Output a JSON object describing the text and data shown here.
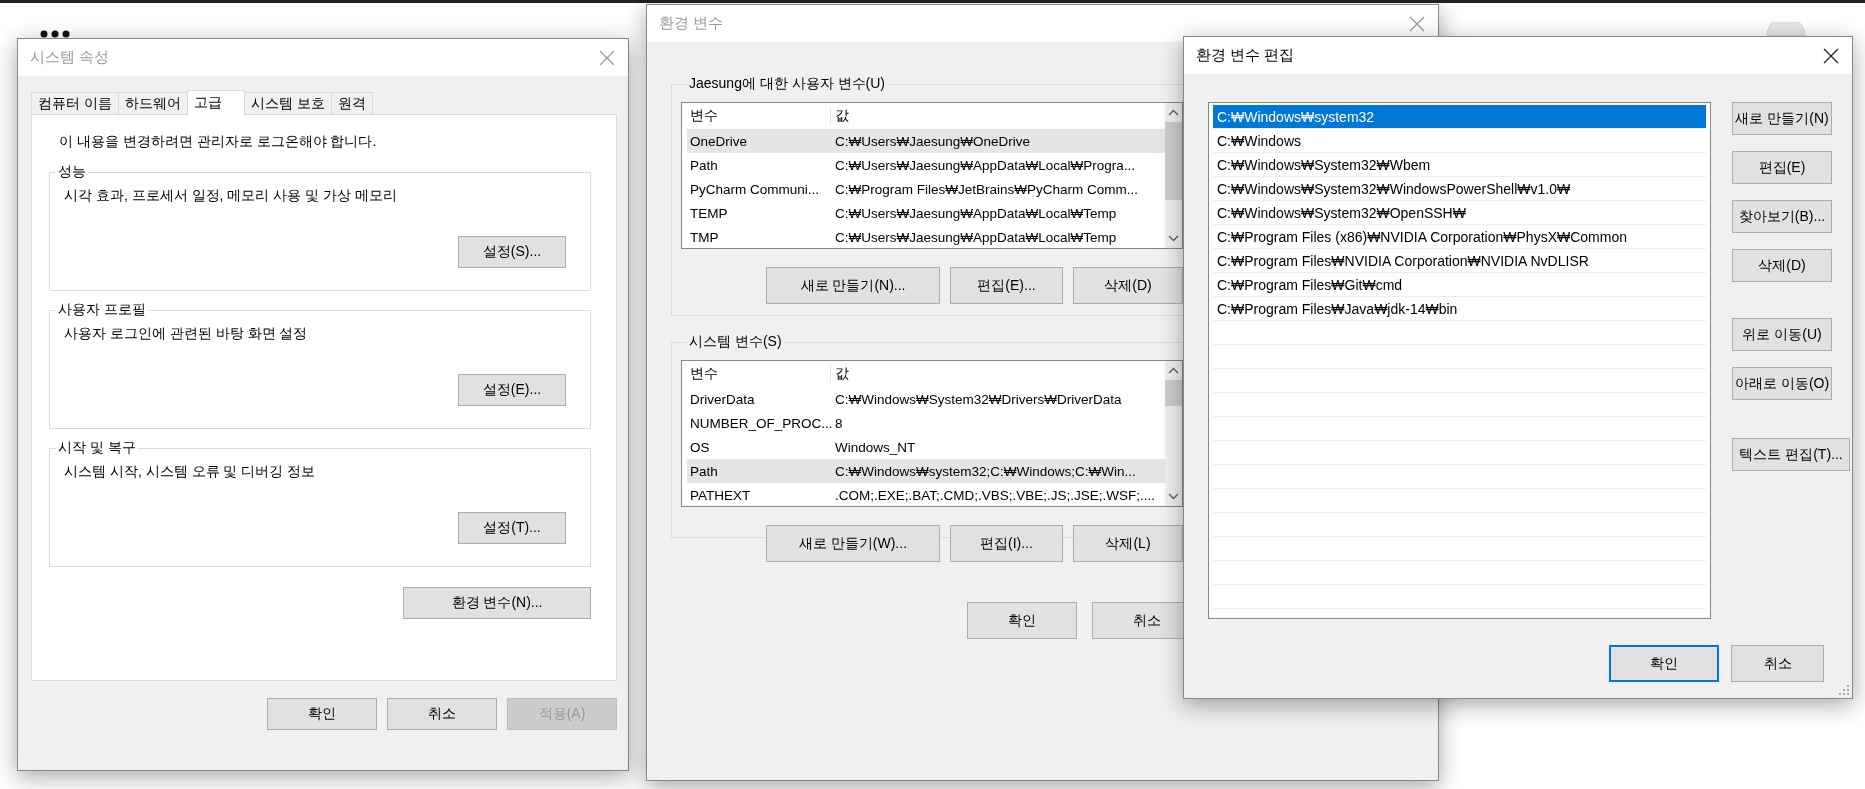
{
  "system_properties": {
    "title": "시스템 속성",
    "active": false,
    "tabs": [
      {
        "label": "컴퓨터 이름",
        "selected": false
      },
      {
        "label": "하드웨어",
        "selected": false
      },
      {
        "label": "고급",
        "selected": true
      },
      {
        "label": "시스템 보호",
        "selected": false
      },
      {
        "label": "원격",
        "selected": false
      }
    ],
    "notice": "이 내용을 변경하려면 관리자로 로그온해야 합니다.",
    "groups": [
      {
        "title": "성능",
        "description": "시각 효과, 프로세서 일정, 메모리 사용 및 가상 메모리",
        "button": "설정(S)..."
      },
      {
        "title": "사용자 프로필",
        "description": "사용자 로그인에 관련된 바탕 화면 설정",
        "button": "설정(E)..."
      },
      {
        "title": "시작 및 복구",
        "description": "시스템 시작, 시스템 오류 및 디버깅 정보",
        "button": "설정(T)..."
      }
    ],
    "env_button": "환경 변수(N)...",
    "buttons": [
      {
        "label": "확인",
        "disabled": false
      },
      {
        "label": "취소",
        "disabled": false
      },
      {
        "label": "적용(A)",
        "disabled": true
      }
    ]
  },
  "environment_variables": {
    "title": "환경 변수",
    "active": false,
    "sections": [
      {
        "title": "Jaesung에 대한 사용자 변수(U)",
        "columns": [
          "변수",
          "값"
        ],
        "rows": [
          {
            "name": "OneDrive",
            "value": "C:₩Users₩Jaesung₩OneDrive",
            "selected": true
          },
          {
            "name": "Path",
            "value": "C:₩Users₩Jaesung₩AppData₩Local₩Progra...",
            "selected": false
          },
          {
            "name": "PyCharm Communi...",
            "value": "C:₩Program Files₩JetBrains₩PyCharm Comm...",
            "selected": false
          },
          {
            "name": "TEMP",
            "value": "C:₩Users₩Jaesung₩AppData₩Local₩Temp",
            "selected": false
          },
          {
            "name": "TMP",
            "value": "C:₩Users₩Jaesung₩AppData₩Local₩Temp",
            "selected": false
          }
        ],
        "buttons": [
          "새로 만들기(N)...",
          "편집(E)...",
          "삭제(D)"
        ]
      },
      {
        "title": "시스템 변수(S)",
        "columns": [
          "변수",
          "값"
        ],
        "rows": [
          {
            "name": "DriverData",
            "value": "C:₩Windows₩System32₩Drivers₩DriverData",
            "selected": false
          },
          {
            "name": "NUMBER_OF_PROC...",
            "value": "8",
            "selected": false
          },
          {
            "name": "OS",
            "value": "Windows_NT",
            "selected": false
          },
          {
            "name": "Path",
            "value": "C:₩Windows₩system32;C:₩Windows;C:₩Win...",
            "selected": true
          },
          {
            "name": "PATHEXT",
            "value": ".COM;.EXE;.BAT;.CMD;.VBS;.VBE;.JS;.JSE;.WSF;....",
            "selected": false
          }
        ],
        "buttons": [
          "새로 만들기(W)...",
          "편집(I)...",
          "삭제(L)"
        ]
      }
    ],
    "buttons": [
      "확인",
      "취소"
    ]
  },
  "edit_variable": {
    "title": "환경 변수 편집",
    "active": true,
    "entries": [
      {
        "text": "C:₩Windows₩system32",
        "selected": true
      },
      {
        "text": "C:₩Windows",
        "selected": false
      },
      {
        "text": "C:₩Windows₩System32₩Wbem",
        "selected": false
      },
      {
        "text": "C:₩Windows₩System32₩WindowsPowerShell₩v1.0₩",
        "selected": false
      },
      {
        "text": "C:₩Windows₩System32₩OpenSSH₩",
        "selected": false
      },
      {
        "text": "C:₩Program Files (x86)₩NVIDIA Corporation₩PhysX₩Common",
        "selected": false
      },
      {
        "text": "C:₩Program Files₩NVIDIA Corporation₩NVIDIA NvDLISR",
        "selected": false
      },
      {
        "text": "C:₩Program Files₩Git₩cmd",
        "selected": false
      },
      {
        "text": "C:₩Program Files₩Java₩jdk-14₩bin",
        "selected": false
      }
    ],
    "side_buttons": [
      {
        "label": "새로 만들기(N)",
        "kind": "button"
      },
      {
        "label": "편집(E)",
        "kind": "button"
      },
      {
        "label": "찾아보기(B)...",
        "kind": "button"
      },
      {
        "label": "삭제(D)",
        "kind": "button"
      },
      {
        "label": "위로 이동(U)",
        "kind": "spaced"
      },
      {
        "label": "아래로 이동(O)",
        "kind": "button"
      },
      {
        "label": "텍스트 편집(T)...",
        "kind": "wide"
      }
    ],
    "buttons": [
      {
        "label": "확인",
        "default": true
      },
      {
        "label": "취소",
        "default": false
      }
    ]
  }
}
